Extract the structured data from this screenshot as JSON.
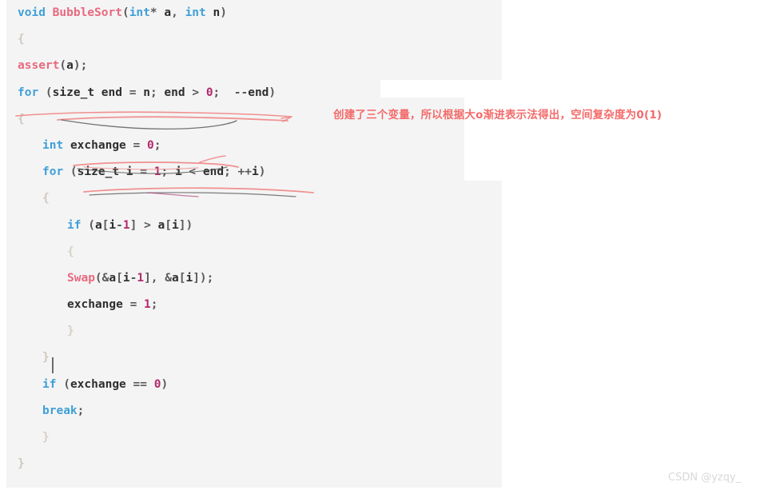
{
  "editor": {
    "language": "C",
    "background_color": "#f4f4f4",
    "code_lines": [
      {
        "indent": 0,
        "tokens": [
          {
            "t": "void",
            "c": "kw"
          },
          {
            "t": " ",
            "c": "pun"
          },
          {
            "t": "BubbleSort",
            "c": "fn"
          },
          {
            "t": "(",
            "c": "pun"
          },
          {
            "t": "int",
            "c": "kw"
          },
          {
            "t": "*",
            "c": "pun"
          },
          {
            "t": " ",
            "c": "pun"
          },
          {
            "t": "a",
            "c": "id"
          },
          {
            "t": ",",
            "c": "pun"
          },
          {
            "t": " ",
            "c": "pun"
          },
          {
            "t": "int",
            "c": "kw"
          },
          {
            "t": " ",
            "c": "pun"
          },
          {
            "t": "n",
            "c": "id"
          },
          {
            "t": ")",
            "c": "pun"
          }
        ]
      },
      {
        "indent": 0,
        "tokens": [
          {
            "t": "{",
            "c": "brace"
          }
        ]
      },
      {
        "indent": 0,
        "tokens": [
          {
            "t": "assert",
            "c": "fn"
          },
          {
            "t": "(",
            "c": "pun"
          },
          {
            "t": "a",
            "c": "id"
          },
          {
            "t": ");",
            "c": "pun"
          }
        ]
      },
      {
        "indent": 0,
        "tokens": [
          {
            "t": "for",
            "c": "kw"
          },
          {
            "t": " (",
            "c": "pun"
          },
          {
            "t": "size_t",
            "c": "id"
          },
          {
            "t": " ",
            "c": "pun"
          },
          {
            "t": "end",
            "c": "id"
          },
          {
            "t": " = ",
            "c": "pun"
          },
          {
            "t": "n",
            "c": "id"
          },
          {
            "t": "; ",
            "c": "pun"
          },
          {
            "t": "end",
            "c": "id"
          },
          {
            "t": " > ",
            "c": "pun"
          },
          {
            "t": "0",
            "c": "num"
          },
          {
            "t": ";  ",
            "c": "pun"
          },
          {
            "t": "--",
            "c": "pun"
          },
          {
            "t": "end",
            "c": "id"
          },
          {
            "t": ")",
            "c": "pun"
          }
        ]
      },
      {
        "indent": 0,
        "tokens": [
          {
            "t": "{",
            "c": "brace"
          }
        ]
      },
      {
        "indent": 1,
        "tokens": [
          {
            "t": "int",
            "c": "kw"
          },
          {
            "t": " ",
            "c": "pun"
          },
          {
            "t": "exchange",
            "c": "id"
          },
          {
            "t": " = ",
            "c": "pun"
          },
          {
            "t": "0",
            "c": "num"
          },
          {
            "t": ";",
            "c": "pun"
          }
        ]
      },
      {
        "indent": 1,
        "tokens": [
          {
            "t": "for",
            "c": "kw"
          },
          {
            "t": " (",
            "c": "pun"
          },
          {
            "t": "size_t",
            "c": "id"
          },
          {
            "t": " ",
            "c": "pun"
          },
          {
            "t": "i",
            "c": "id"
          },
          {
            "t": " = ",
            "c": "pun"
          },
          {
            "t": "1",
            "c": "num"
          },
          {
            "t": "; ",
            "c": "pun"
          },
          {
            "t": "i",
            "c": "id"
          },
          {
            "t": " < ",
            "c": "pun"
          },
          {
            "t": "end",
            "c": "id"
          },
          {
            "t": "; ",
            "c": "pun"
          },
          {
            "t": "++",
            "c": "pun"
          },
          {
            "t": "i",
            "c": "id"
          },
          {
            "t": ")",
            "c": "pun"
          }
        ]
      },
      {
        "indent": 1,
        "tokens": [
          {
            "t": "{",
            "c": "brace"
          }
        ]
      },
      {
        "indent": 2,
        "tokens": [
          {
            "t": "if",
            "c": "kw"
          },
          {
            "t": " (",
            "c": "pun"
          },
          {
            "t": "a",
            "c": "id"
          },
          {
            "t": "[",
            "c": "pun"
          },
          {
            "t": "i",
            "c": "id"
          },
          {
            "t": "-",
            "c": "pun"
          },
          {
            "t": "1",
            "c": "num"
          },
          {
            "t": "] > ",
            "c": "pun"
          },
          {
            "t": "a",
            "c": "id"
          },
          {
            "t": "[",
            "c": "pun"
          },
          {
            "t": "i",
            "c": "id"
          },
          {
            "t": "])",
            "c": "pun"
          }
        ]
      },
      {
        "indent": 2,
        "tokens": [
          {
            "t": "{",
            "c": "brace-dim"
          }
        ]
      },
      {
        "indent": 2,
        "tokens": [
          {
            "t": "Swap",
            "c": "fn"
          },
          {
            "t": "(&",
            "c": "pun"
          },
          {
            "t": "a",
            "c": "id"
          },
          {
            "t": "[",
            "c": "pun"
          },
          {
            "t": "i",
            "c": "id"
          },
          {
            "t": "-",
            "c": "pun"
          },
          {
            "t": "1",
            "c": "num"
          },
          {
            "t": "], &",
            "c": "pun"
          },
          {
            "t": "a",
            "c": "id"
          },
          {
            "t": "[",
            "c": "pun"
          },
          {
            "t": "i",
            "c": "id"
          },
          {
            "t": "]);",
            "c": "pun"
          }
        ]
      },
      {
        "indent": 2,
        "tokens": [
          {
            "t": "exchange",
            "c": "id"
          },
          {
            "t": " = ",
            "c": "pun"
          },
          {
            "t": "1",
            "c": "num"
          },
          {
            "t": ";",
            "c": "pun"
          }
        ]
      },
      {
        "indent": 2,
        "tokens": [
          {
            "t": "}",
            "c": "brace-dim"
          }
        ]
      },
      {
        "indent": 1,
        "tokens": [
          {
            "t": "}",
            "c": "brace"
          }
        ]
      },
      {
        "indent": 1,
        "tokens": [
          {
            "t": "if",
            "c": "kw"
          },
          {
            "t": " (",
            "c": "pun"
          },
          {
            "t": "exchange",
            "c": "id"
          },
          {
            "t": " == ",
            "c": "pun"
          },
          {
            "t": "0",
            "c": "num"
          },
          {
            "t": ")",
            "c": "pun"
          }
        ]
      },
      {
        "indent": 1,
        "tokens": [
          {
            "t": "break",
            "c": "kw"
          },
          {
            "t": ";",
            "c": "pun"
          }
        ]
      },
      {
        "indent": 1,
        "tokens": [
          {
            "t": "}",
            "c": "brace-dim"
          }
        ]
      },
      {
        "indent": 0,
        "tokens": [
          {
            "t": "}",
            "c": "brace"
          }
        ]
      }
    ]
  },
  "annotation": {
    "text": "创建了三个变量，所以根据大o渐进表示法得出，空间复杂度为0(1)",
    "color": "#f46a6a"
  },
  "ink_marks": {
    "description": "hand-drawn underlines and curves over the two for-loop / declaration lines",
    "red_color": "#f08a8a",
    "gray_color": "#7d7d7d"
  },
  "watermark": {
    "text": "CSDN @yzqy_",
    "color": "#d8d8d8"
  }
}
